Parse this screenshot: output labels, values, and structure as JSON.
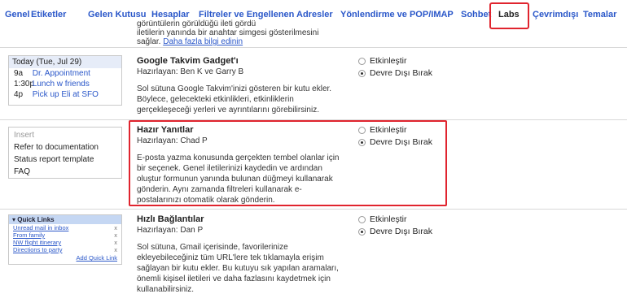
{
  "tabs": [
    "Genel",
    "Etiketler",
    "Gelen Kutusu",
    "Hesaplar",
    "Filtreler ve Engellenen Adresler",
    "Yönlendirme ve POP/IMAP",
    "Sohbet",
    "Labs",
    "Çevrimdışı",
    "Temalar"
  ],
  "selected_tab": "Labs",
  "partial": {
    "line1": "görüntülerin görüldüğü ileti gördü",
    "line2": "iletilerin yanında bir anahtar simgesi gösterilmesini",
    "line3_prefix": "sağlar.",
    "link": "Daha fazla bilgi edinin"
  },
  "calendar_preview": {
    "header": "Today (Tue, Jul 29)",
    "events": [
      {
        "time": "9a",
        "desc": "Dr. Appointment"
      },
      {
        "time": "1:30p",
        "desc": "Lunch w friends"
      },
      {
        "time": "4p",
        "desc": "Pick up Eli at SFO"
      }
    ]
  },
  "canned_preview": {
    "items": [
      "Insert",
      "Refer to documentation",
      "Status report template",
      "FAQ"
    ]
  },
  "quicklinks_preview": {
    "header": "▾ Quick Links",
    "links": [
      "Unread mail in inbox",
      "From family",
      "NW flight itinerary",
      "Directions to party"
    ],
    "remove": "x",
    "add": "Add Quick Link"
  },
  "labs": [
    {
      "title": "Google Takvim Gadget'ı",
      "author": "Hazırlayan: Ben K ve Garry B",
      "desc": "Sol sütuna Google Takvim'inizi gösteren bir kutu ekler. Böylece, gelecekteki etkinlikleri, etkinliklerin gerçekleşeceği yerleri ve ayrıntılarını görebilirsiniz.",
      "enable": "Etkinleştir",
      "disable": "Devre Dışı Bırak"
    },
    {
      "title": "Hazır Yanıtlar",
      "author": "Hazırlayan: Chad P",
      "desc": "E-posta yazma konusunda gerçekten tembel olanlar için bir seçenek. Genel iletilerinizi kaydedin ve ardından oluştur formunun yanında bulunan düğmeyi kullanarak gönderin. Aynı zamanda filtreleri kullanarak e-postalarınızı otomatik olarak gönderin.",
      "enable": "Etkinleştir",
      "disable": "Devre Dışı Bırak"
    },
    {
      "title": "Hızlı Bağlantılar",
      "author": "Hazırlayan: Dan P",
      "desc": "Sol sütuna, Gmail içerisinde, favorilerinize ekleyebileceğiniz tüm URL'lere tek tıklamayla erişim sağlayan bir kutu ekler. Bu kutuyu sık yapılan aramaları, önemli kişisel iletileri ve daha fazlasını kaydetmek için kullanabilirsiniz.",
      "enable": "Etkinleştir",
      "disable": "Devre Dışı Bırak"
    }
  ],
  "colors": {
    "link": "#2a57c9",
    "highlight": "#e0242e"
  }
}
